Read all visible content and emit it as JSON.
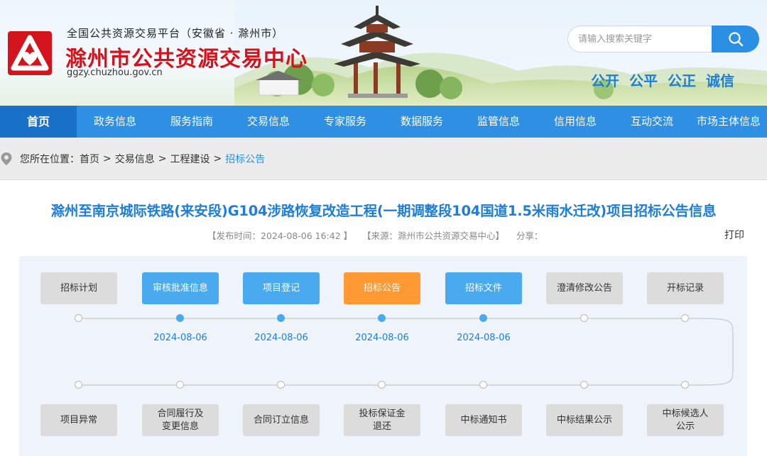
{
  "header": {
    "platform_line": "全国公共资源交易平台（安徽省 · 滁州市）",
    "site_name": "滁州市公共资源交易中心",
    "domain": "ggzy.chuzhou.gov.cn",
    "search_placeholder": "请输入搜索关键字",
    "slogans": [
      "公开",
      "公平",
      "公正",
      "诚信"
    ]
  },
  "nav": {
    "items": [
      {
        "label": "首页",
        "active": true
      },
      {
        "label": "政务信息"
      },
      {
        "label": "服务指南"
      },
      {
        "label": "交易信息"
      },
      {
        "label": "专家服务"
      },
      {
        "label": "数据服务"
      },
      {
        "label": "监管信息"
      },
      {
        "label": "信用信息"
      },
      {
        "label": "互动交流"
      },
      {
        "label": "市场主体信息"
      }
    ]
  },
  "breadcrumb": {
    "prefix": "您所在位置：",
    "items": [
      "首页",
      "交易信息",
      "工程建设",
      "招标公告"
    ],
    "separator": ">"
  },
  "article": {
    "title": "滁州至南京城际铁路(来安段)G104涉路恢复改造工程(一期调整段104国道1.5米雨水迁改)项目招标公告信息",
    "publish_time": "【发布时间：2024-08-06 16:42 】",
    "source": "【来源：滁州市公共资源交易中心】",
    "share": "分享：",
    "print": "打印"
  },
  "flow": {
    "top_steps": [
      {
        "label": "招标计划",
        "status": "pending",
        "date": ""
      },
      {
        "label": "审核批准信息",
        "status": "done",
        "date": "2024-08-06"
      },
      {
        "label": "项目登记",
        "status": "done",
        "date": "2024-08-06"
      },
      {
        "label": "招标公告",
        "status": "current",
        "date": "2024-08-06"
      },
      {
        "label": "招标文件",
        "status": "done",
        "date": "2024-08-06"
      },
      {
        "label": "澄清修改公告",
        "status": "pending",
        "date": ""
      },
      {
        "label": "开标记录",
        "status": "pending",
        "date": ""
      }
    ],
    "bottom_steps": [
      {
        "label": "项目异常",
        "status": "pending"
      },
      {
        "label": "合同履行及\n变更信息",
        "status": "pending"
      },
      {
        "label": "合同订立信息",
        "status": "pending"
      },
      {
        "label": "投标保证金\n退还",
        "status": "pending"
      },
      {
        "label": "中标通知书",
        "status": "pending"
      },
      {
        "label": "中标结果公示",
        "status": "pending"
      },
      {
        "label": "中标候选人\n公示",
        "status": "pending"
      }
    ]
  },
  "colors": {
    "brand_red": "#d4141c",
    "brand_blue": "#2f8fe3",
    "nav_active": "#1a72c8",
    "step_done": "#4aaaf0",
    "step_current": "#ff9933",
    "step_pending": "#dcdcdc"
  },
  "icons": {
    "logo": "chuzhou-logo-icon",
    "search": "search-icon",
    "location": "location-pin-icon"
  }
}
